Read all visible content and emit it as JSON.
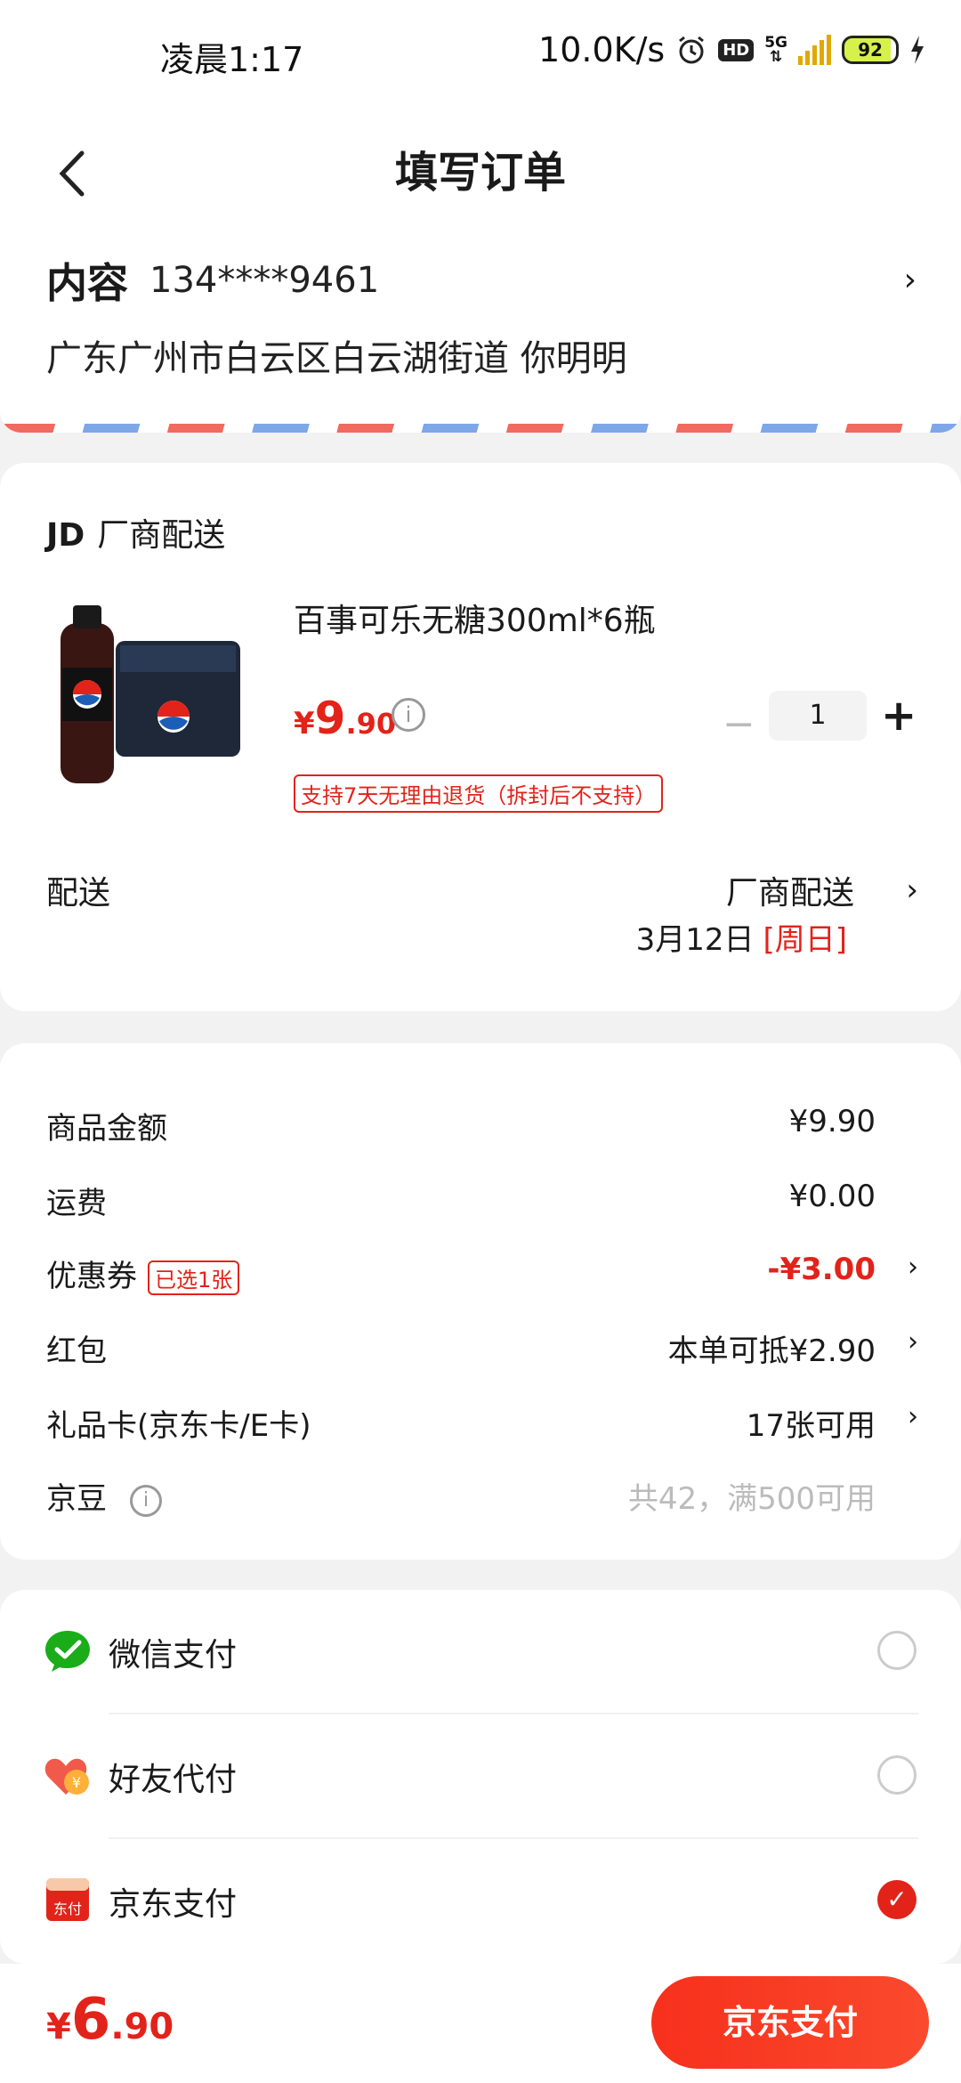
{
  "status_bar": {
    "time": "凌晨1:17",
    "net_speed": "10.0K/s",
    "hd": "HD",
    "network": "5G",
    "battery": "92"
  },
  "header": {
    "title": "填写订单",
    "back_icon": "back-chevron-icon"
  },
  "address": {
    "name": "内容",
    "phone": "134****9461",
    "address_line": "广东广州市白云区白云湖街道 你明明",
    "chevron": "›"
  },
  "shop": {
    "logo": "JD",
    "name": "厂商配送",
    "product": {
      "name": "百事可乐无糖300ml*6瓶",
      "price_symbol": "¥",
      "price_int": "9",
      "price_dec": ".90",
      "quantity": "1",
      "minus": "−",
      "plus": "+",
      "return_policy": "支持7天无理由退货（拆封后不支持）"
    },
    "delivery": {
      "label": "配送",
      "method": "厂商配送",
      "date": "3月12日",
      "weekday": "[周日]",
      "chevron": "›"
    }
  },
  "summary": {
    "rows": [
      {
        "label": "商品金额",
        "value": "¥9.90"
      },
      {
        "label": "运费",
        "value": "¥0.00"
      },
      {
        "label": "优惠券",
        "badge": "已选1张",
        "value": "-¥3.00"
      },
      {
        "label": "红包",
        "value": "本单可抵¥2.90"
      },
      {
        "label": "礼品卡(京东卡/E卡)",
        "value": "17张可用"
      },
      {
        "label": "京豆",
        "value": "共42，满500可用"
      }
    ],
    "chevron": "›",
    "info_mark": "i"
  },
  "payment": {
    "options": [
      {
        "label": "微信支付",
        "icon": "wechat-pay-icon",
        "selected": false
      },
      {
        "label": "好友代付",
        "icon": "friend-pay-icon",
        "selected": false
      },
      {
        "label": "京东支付",
        "icon": "jd-pay-icon",
        "selected": true
      }
    ],
    "check": "✓"
  },
  "footer": {
    "total_symbol": "¥",
    "total_int": "6",
    "total_dec": ".90",
    "pay_button": "京东支付"
  },
  "colors": {
    "accent": "#e2231a",
    "wechat": "#1aad19",
    "background": "#f2f2f2"
  }
}
